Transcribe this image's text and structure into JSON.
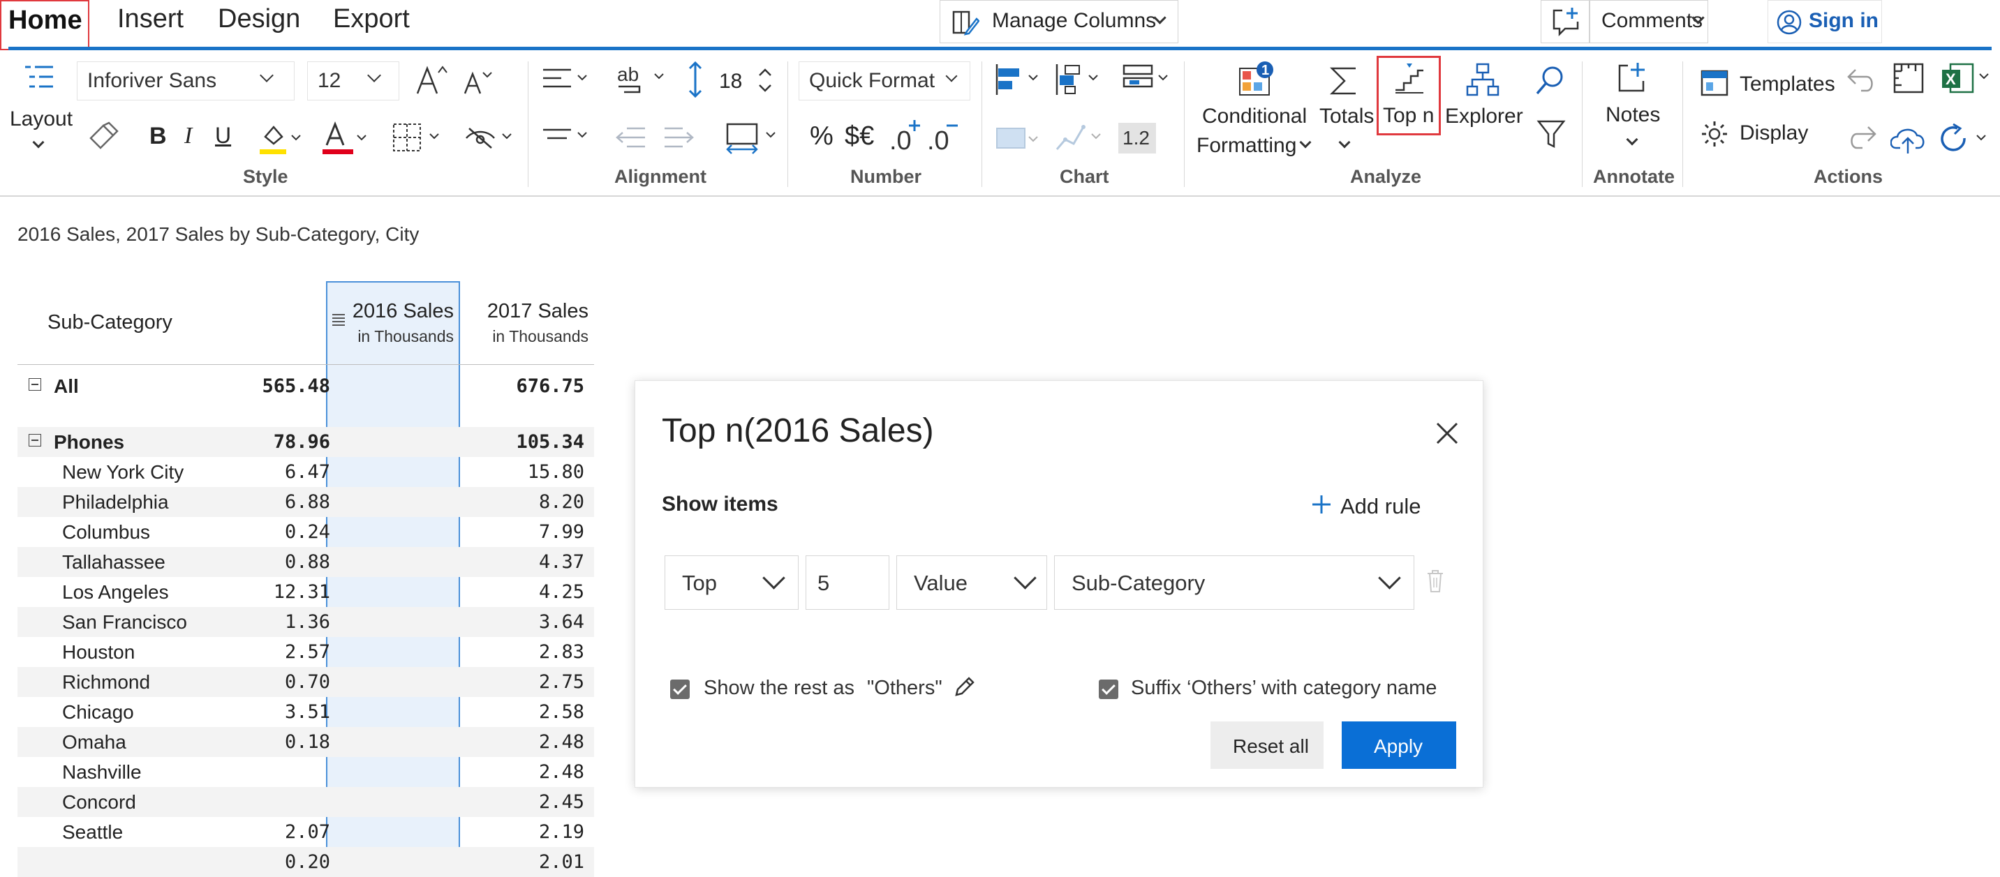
{
  "tabs": {
    "home": "Home",
    "insert": "Insert",
    "design": "Design",
    "export": "Export"
  },
  "topbar": {
    "manage_columns": "Manage Columns",
    "comments": "Comments",
    "sign_in": "Sign in"
  },
  "ribbon": {
    "layout": "Layout",
    "font_name": "Inforiver Sans",
    "font_size": "12",
    "row_height": "18",
    "quick_format": "Quick Format",
    "number_format_pct": "%",
    "number_format_cur": "$€",
    "chart_value_badge": "1.2",
    "conditional_formatting": [
      "Conditional",
      "Formatting"
    ],
    "conditional_badge": "1",
    "totals": "Totals",
    "top_n": "Top n",
    "explorer": "Explorer",
    "notes": "Notes",
    "templates": "Templates",
    "display": "Display",
    "groups": {
      "style": "Style",
      "alignment": "Alignment",
      "number": "Number",
      "chart": "Chart",
      "analyze": "Analyze",
      "annotate": "Annotate",
      "actions": "Actions"
    }
  },
  "report": {
    "title": "2016 Sales, 2017 Sales by Sub-Category, City",
    "columns": [
      {
        "label": "Sub-Category"
      },
      {
        "label": "2016 Sales",
        "sub": "in Thousands"
      },
      {
        "label": "2017 Sales",
        "sub": "in Thousands"
      }
    ],
    "rows": [
      {
        "name": "All",
        "v2016": "565.48",
        "v2017": "676.75",
        "level": "total"
      },
      {
        "name": "Phones",
        "v2016": "78.96",
        "v2017": "105.34",
        "level": "group"
      },
      {
        "name": "New York City",
        "v2016": "6.47",
        "v2017": "15.80"
      },
      {
        "name": "Philadelphia",
        "v2016": "6.88",
        "v2017": "8.20"
      },
      {
        "name": "Columbus",
        "v2016": "0.24",
        "v2017": "7.99"
      },
      {
        "name": "Tallahassee",
        "v2016": "0.88",
        "v2017": "4.37"
      },
      {
        "name": "Los Angeles",
        "v2016": "12.31",
        "v2017": "4.25"
      },
      {
        "name": "San Francisco",
        "v2016": "1.36",
        "v2017": "3.64"
      },
      {
        "name": "Houston",
        "v2016": "2.57",
        "v2017": "2.83"
      },
      {
        "name": "Richmond",
        "v2016": "0.70",
        "v2017": "2.75"
      },
      {
        "name": "Chicago",
        "v2016": "3.51",
        "v2017": "2.58"
      },
      {
        "name": "Omaha",
        "v2016": "0.18",
        "v2017": "2.48"
      },
      {
        "name": "Nashville",
        "v2016": "",
        "v2017": "2.48"
      },
      {
        "name": "Concord",
        "v2016": "",
        "v2017": "2.45"
      },
      {
        "name": "Seattle",
        "v2016": "2.07",
        "v2017": "2.19"
      },
      {
        "name": "",
        "v2016": "0.20",
        "v2017": "2.01"
      }
    ]
  },
  "dialog": {
    "title": "Top n(2016 Sales)",
    "show_items": "Show items",
    "add_rule": "Add rule",
    "rule": {
      "direction": "Top",
      "count": "5",
      "mode": "Value",
      "dimension": "Sub-Category"
    },
    "show_rest_label": "Show the rest as",
    "show_rest_value": "\"Others\"",
    "suffix_label": "Suffix ‘Others’ with category name",
    "reset": "Reset all",
    "apply": "Apply",
    "accent": "#0a6fd6"
  }
}
